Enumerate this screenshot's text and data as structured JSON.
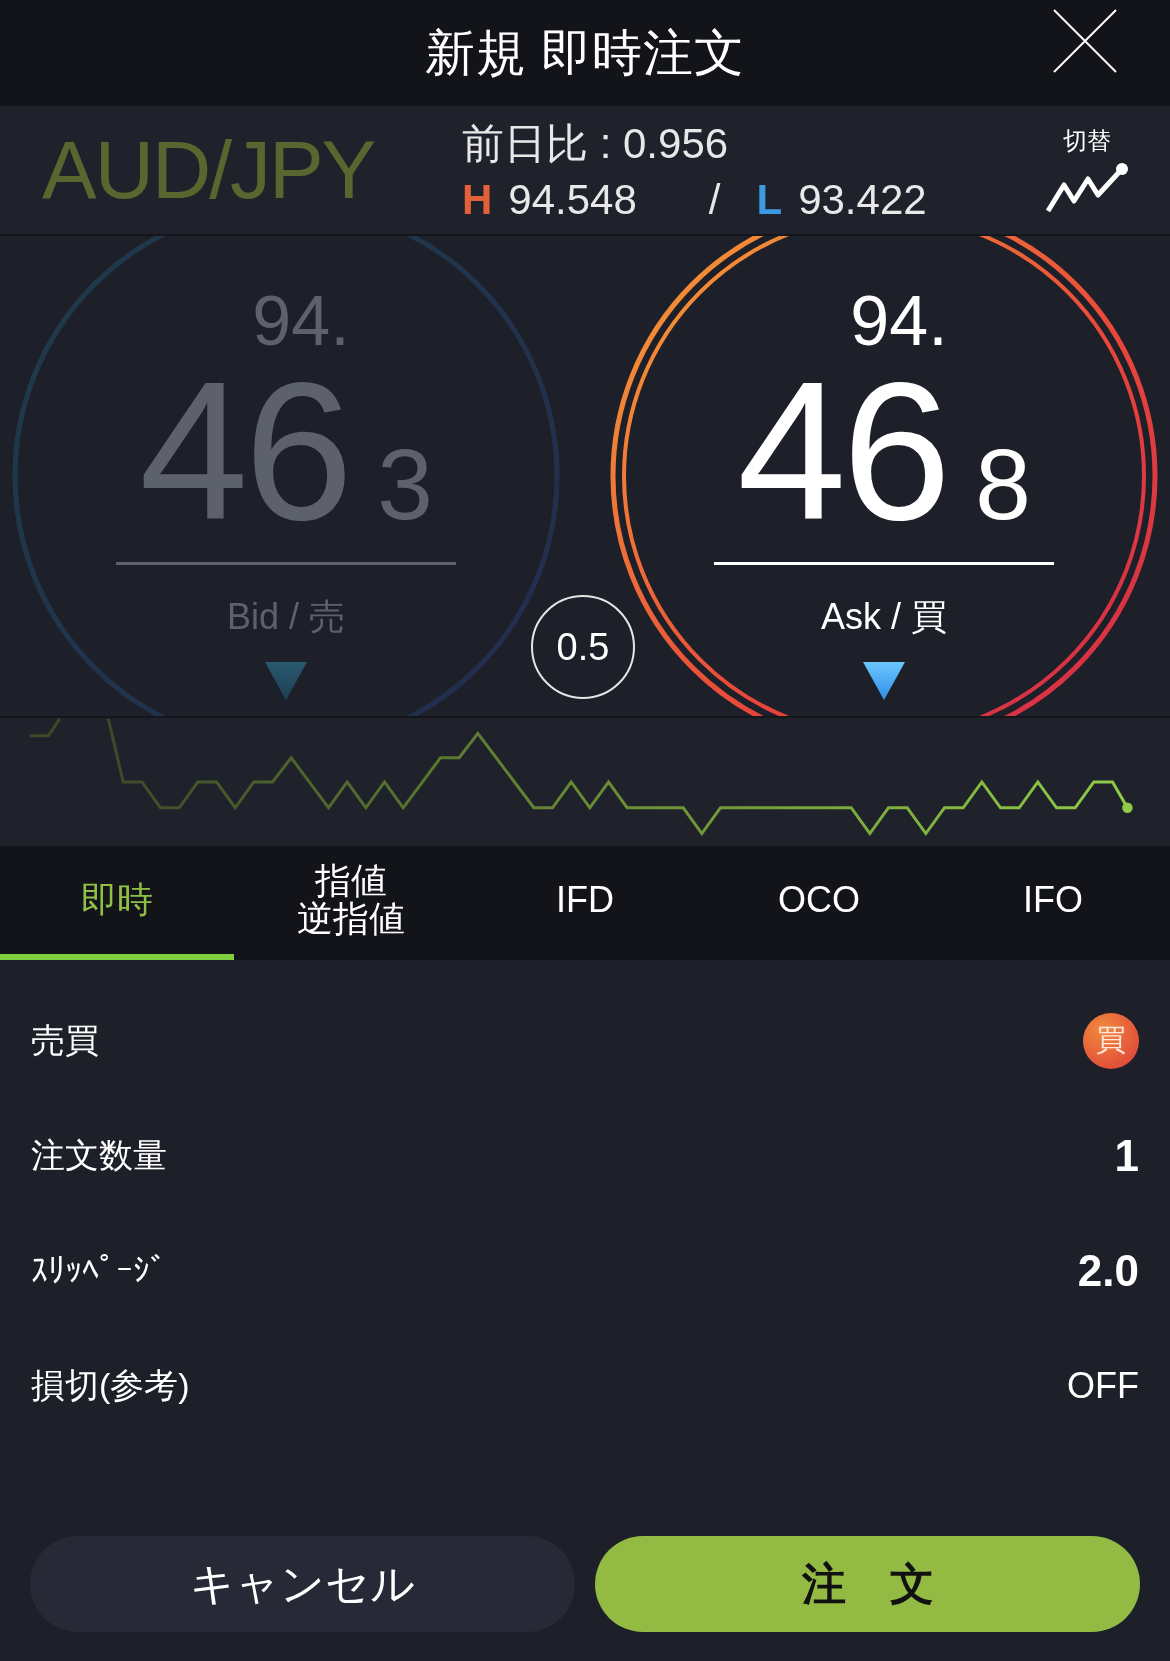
{
  "header": {
    "title": "新規 即時注文"
  },
  "pair": {
    "symbol": "AUD/JPY",
    "change": "前日比 : 0.956",
    "high_mark": "H",
    "high": "94.548",
    "separator": "/",
    "low_mark": "L",
    "low": "93.422",
    "toggle_label": "切替"
  },
  "quotes": [
    {
      "selected": false,
      "prefix": "94.",
      "main": "46",
      "pip": "3",
      "label": "Bid / 売"
    },
    {
      "selected": true,
      "prefix": "94.",
      "main": "46",
      "pip": "8",
      "label": "Ask / 買"
    }
  ],
  "spread": "0.5",
  "order_tabs": [
    {
      "lines": [
        "即時"
      ],
      "selected": true
    },
    {
      "lines": [
        "指値",
        "逆指値"
      ],
      "selected": false
    },
    {
      "lines": [
        "IFD"
      ],
      "selected": false
    },
    {
      "lines": [
        "OCO"
      ],
      "selected": false
    },
    {
      "lines": [
        "IFO"
      ],
      "selected": false
    }
  ],
  "fields": [
    {
      "kind": "badge",
      "label": "売買",
      "value": "買"
    },
    {
      "kind": "number",
      "label": "注文数量",
      "value": "1"
    },
    {
      "kind": "number",
      "label": "ｽﾘｯﾍﾟｰｼﾞ",
      "value": "2.0"
    },
    {
      "kind": "text",
      "label": "損切(参考)",
      "value": "OFF"
    }
  ],
  "buttons": [
    {
      "kind": "cancel",
      "label": "キャンセル"
    },
    {
      "kind": "primary",
      "label": "注　文"
    }
  ]
}
